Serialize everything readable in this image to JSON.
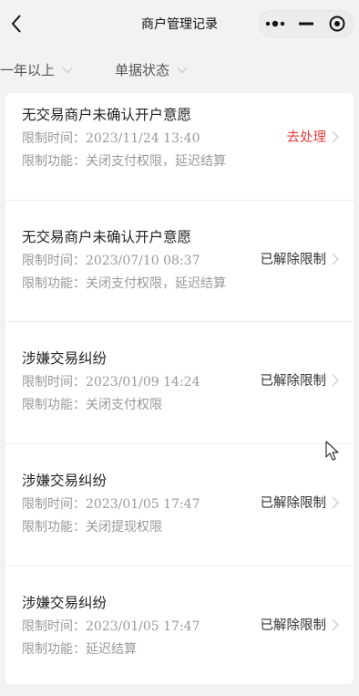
{
  "nav": {
    "title": "商户管理记录"
  },
  "filters": [
    {
      "label": "一年以上"
    },
    {
      "label": "单据状态"
    }
  ],
  "records": [
    {
      "title": "无交易商户未确认开户意愿",
      "time_label": "限制时间：",
      "time_value": "2023/11/24 13:40",
      "function_label": "限制功能：",
      "function_value": "关闭支付权限，延迟结算",
      "status": "去处理",
      "status_color": "#e2403d"
    },
    {
      "title": "无交易商户未确认开户意愿",
      "time_label": "限制时间：",
      "time_value": "2023/07/10 08:37",
      "function_label": "限制功能：",
      "function_value": "关闭支付权限，延迟结算",
      "status": "已解除限制",
      "status_color": "#333333"
    },
    {
      "title": "涉嫌交易纠纷",
      "time_label": "限制时间：",
      "time_value": "2023/01/09 14:24",
      "function_label": "限制功能：",
      "function_value": "关闭支付权限",
      "status": "已解除限制",
      "status_color": "#333333"
    },
    {
      "title": "涉嫌交易纠纷",
      "time_label": "限制时间：",
      "time_value": "2023/01/05 17:47",
      "function_label": "限制功能：",
      "function_value": "关闭提现权限",
      "status": "已解除限制",
      "status_color": "#333333"
    },
    {
      "title": "涉嫌交易纠纷",
      "time_label": "限制时间：",
      "time_value": "2023/01/05 17:47",
      "function_label": "限制功能：",
      "function_value": "延迟结算",
      "status": "已解除限制",
      "status_color": "#333333"
    }
  ]
}
